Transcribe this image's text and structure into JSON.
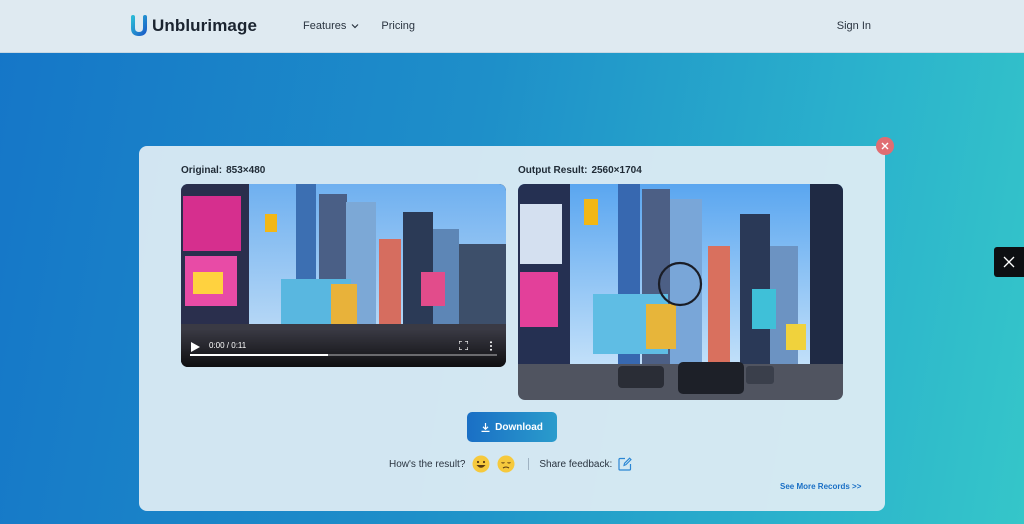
{
  "header": {
    "logo_text": "Unblurimage",
    "nav": [
      {
        "label": "Features",
        "has_dropdown": true
      },
      {
        "label": "Pricing",
        "has_dropdown": false
      }
    ],
    "signin_label": "Sign In"
  },
  "original": {
    "label": "Original:",
    "dimensions": "853×480",
    "video_time": "0:00 / 0:11",
    "progress": 0.45
  },
  "output": {
    "label": "Output Result:",
    "dimensions": "2560×1704"
  },
  "actions": {
    "download_label": "Download",
    "result_question": "How's the result?",
    "share_feedback_label": "Share feedback:",
    "see_more_label": "See More Records >>"
  },
  "icons": {
    "logo": "u-logo-icon",
    "close": "close-icon",
    "download": "download-icon",
    "happy": "happy-emoji-icon",
    "sad": "sad-emoji-icon",
    "edit": "edit-icon",
    "social": "x-logo-icon"
  },
  "colors": {
    "accent": "#1a6fc5",
    "close_red": "#e06d72"
  }
}
